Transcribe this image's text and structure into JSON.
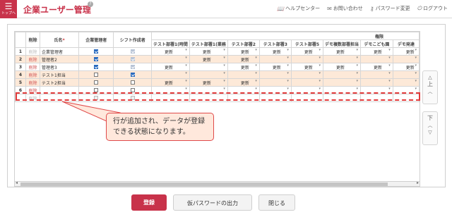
{
  "header": {
    "menu_label": "トップへ",
    "title": "企業ユーザー管理",
    "help_icon": "?",
    "links": [
      {
        "icon": "book-icon",
        "label": "ヘルプセンター"
      },
      {
        "icon": "mail-icon",
        "label": "お問い合わせ"
      },
      {
        "icon": "key-icon",
        "label": "パスワード変更"
      },
      {
        "icon": "logout-icon",
        "label": "ログアウト"
      }
    ]
  },
  "table": {
    "group_header": "権限",
    "headers": {
      "delete": "削除",
      "name": "氏名",
      "required_mark": "*",
      "admin": "企業管理者",
      "shift": "シフト作成者",
      "depts": [
        "テスト部署1(時間",
        "テスト部署1(業務",
        "テスト部署2",
        "テスト部署3",
        "テスト部署5",
        "デモ複数部署担当",
        "デモこども園",
        "デモ発達"
      ]
    },
    "rows": [
      {
        "no": "1",
        "del": "削除",
        "name": "企業管理者",
        "vals": [
          "更新",
          "更新",
          "更新",
          "更新",
          "更新",
          "更新",
          "更新",
          "更新"
        ]
      },
      {
        "no": "2",
        "del": "削除",
        "name": "管理者2",
        "vals": [
          "",
          "更新",
          "更新",
          "",
          "",
          "",
          "",
          ""
        ]
      },
      {
        "no": "3",
        "del": "削除",
        "name": "管理者3",
        "vals": [
          "更新",
          "",
          "更新",
          "更新",
          "更新",
          "更新",
          "更新",
          "更新"
        ]
      },
      {
        "no": "4",
        "del": "削除",
        "name": "テスト1担当",
        "vals": [
          "",
          "",
          "",
          "",
          "",
          "",
          "",
          ""
        ]
      },
      {
        "no": "5",
        "del": "削除",
        "name": "テスト2担当",
        "vals": [
          "更新",
          "更新",
          "更新",
          "",
          "",
          "",
          "",
          ""
        ]
      },
      {
        "no": "6",
        "del": "削除",
        "name": "",
        "vals": [
          "",
          "",
          "",
          "",
          "",
          "",
          "",
          ""
        ]
      },
      {
        "no": "",
        "del": "削除",
        "name": "",
        "vals": [
          "",
          "",
          "",
          "",
          "",
          "",
          "",
          ""
        ]
      }
    ]
  },
  "side": {
    "up_label": "上",
    "down_label": "下"
  },
  "callout": "行が追加され、データが登録できる状態になります。",
  "footer": {
    "register": "登録",
    "temp_password": "仮パスワードの出力",
    "close": "閉じる"
  },
  "colors": {
    "accent": "#c8324a",
    "highlight": "#e23a3a",
    "row_tint": "#fde9d8"
  }
}
